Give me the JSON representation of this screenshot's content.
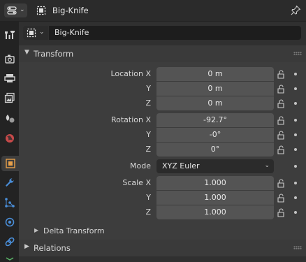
{
  "header": {
    "editor_type_icon": "properties-editor-icon",
    "object_icon": "object-icon",
    "title": "Big-Knife",
    "pin_icon": "pin-icon"
  },
  "tabs": [
    {
      "id": "tool",
      "icon": "tool-icon",
      "active": false
    },
    {
      "id": "render",
      "icon": "render-icon",
      "active": false
    },
    {
      "id": "output",
      "icon": "output-icon",
      "active": false
    },
    {
      "id": "view-layer",
      "icon": "view-layer-icon",
      "active": false
    },
    {
      "id": "scene",
      "icon": "scene-icon",
      "active": false
    },
    {
      "id": "world",
      "icon": "world-icon",
      "active": false
    },
    {
      "id": "object",
      "icon": "object-icon",
      "active": true
    },
    {
      "id": "modifiers",
      "icon": "wrench-icon",
      "active": false
    },
    {
      "id": "particles",
      "icon": "particles-icon",
      "active": false
    },
    {
      "id": "physics",
      "icon": "physics-icon",
      "active": false
    },
    {
      "id": "constraints",
      "icon": "constraints-icon",
      "active": false
    }
  ],
  "object": {
    "name": "Big-Knife"
  },
  "transform": {
    "title": "Transform",
    "location": {
      "labels": [
        "Location X",
        "Y",
        "Z"
      ],
      "values": [
        "0 m",
        "0 m",
        "0 m"
      ]
    },
    "rotation": {
      "labels": [
        "Rotation X",
        "Y",
        "Z"
      ],
      "values": [
        "-92.7°",
        "-0°",
        "0°"
      ]
    },
    "mode": {
      "label": "Mode",
      "value": "XYZ Euler"
    },
    "scale": {
      "labels": [
        "Scale X",
        "Y",
        "Z"
      ],
      "values": [
        "1.000",
        "1.000",
        "1.000"
      ]
    },
    "delta": {
      "title": "Delta Transform"
    }
  },
  "relations": {
    "title": "Relations"
  },
  "colors": {
    "accent": "#e8a04a",
    "field": "#545454",
    "panel": "#3d3d3d"
  }
}
